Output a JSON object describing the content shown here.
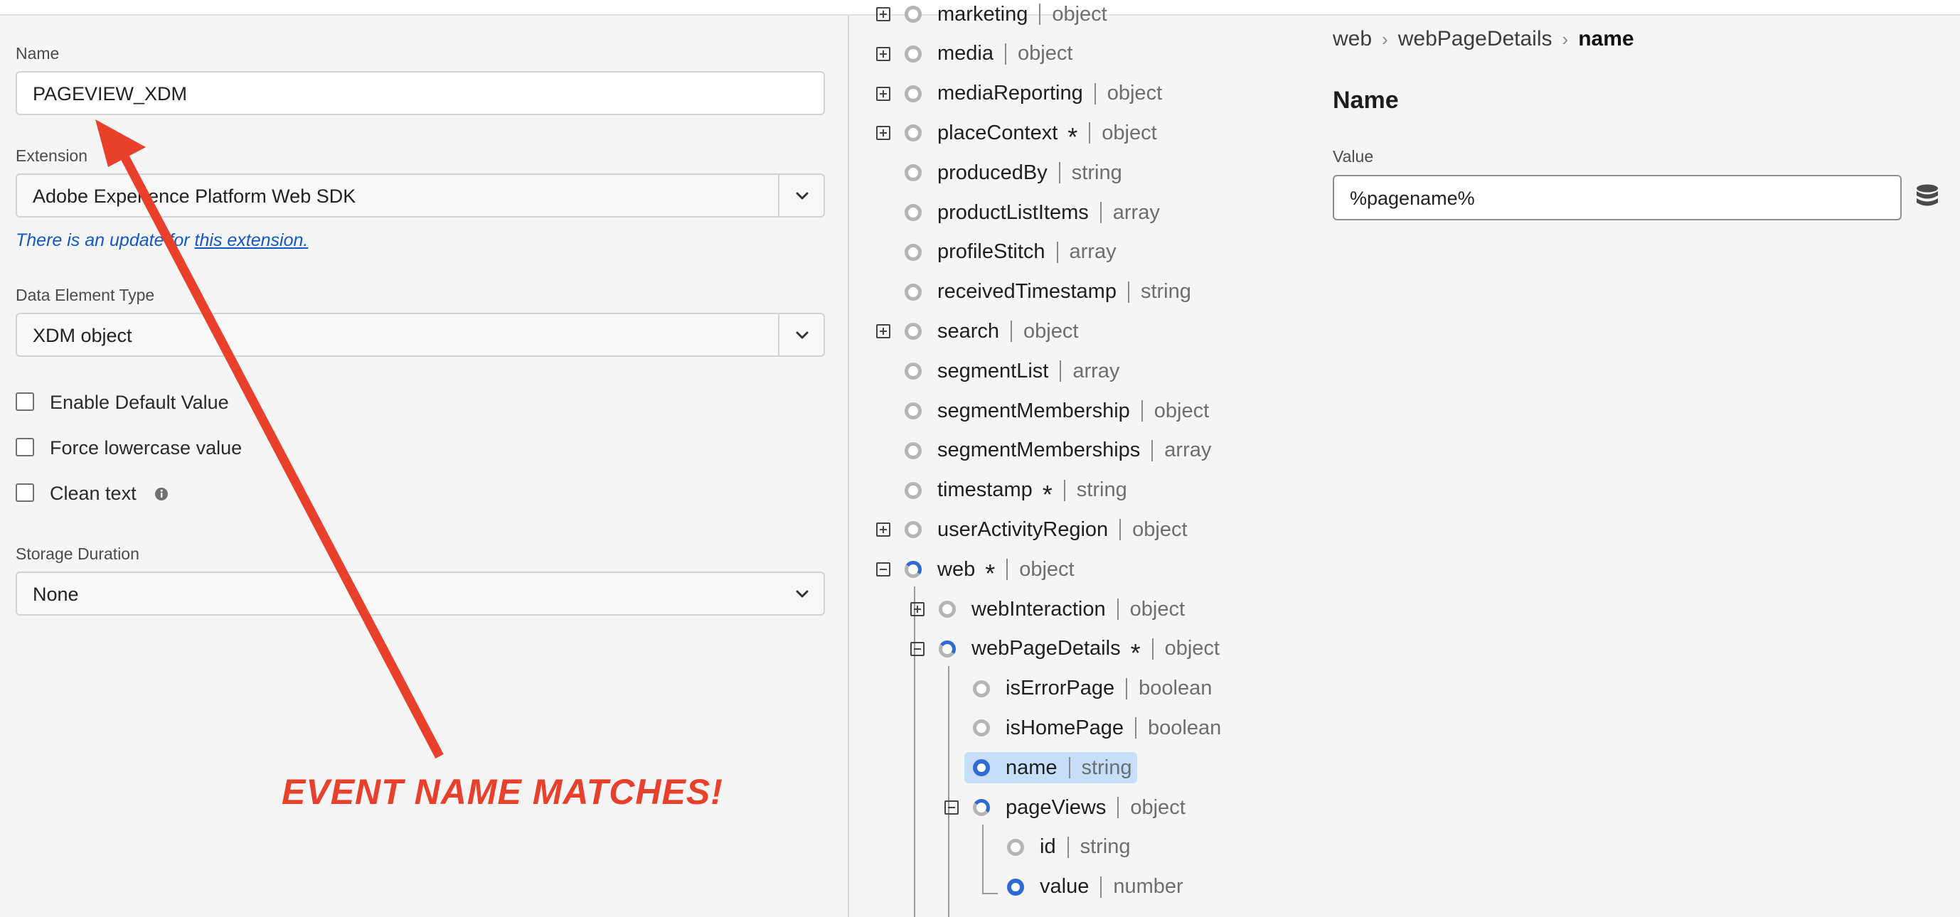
{
  "form": {
    "name_label": "Name",
    "name_value": "PAGEVIEW_XDM",
    "extension_label": "Extension",
    "extension_value": "Adobe Experience Platform Web SDK",
    "update_notice_prefix": "There is an update for ",
    "update_notice_link": "this extension.",
    "type_label": "Data Element Type",
    "type_value": "XDM object",
    "checkboxes": [
      {
        "label": "Enable Default Value",
        "checked": false
      },
      {
        "label": "Force lowercase value",
        "checked": false
      },
      {
        "label": "Clean text",
        "checked": false
      }
    ],
    "storage_label": "Storage Duration",
    "storage_value": "None"
  },
  "annotation": {
    "callout": "EVENT NAME MATCHES!",
    "color": "#e8402b"
  },
  "tree": {
    "rows": [
      {
        "name": "marketing",
        "type": "object",
        "required": false,
        "expander": "plus",
        "dot": "empty"
      },
      {
        "name": "media",
        "type": "object",
        "required": false,
        "expander": "plus",
        "dot": "empty"
      },
      {
        "name": "mediaReporting",
        "type": "object",
        "required": false,
        "expander": "plus",
        "dot": "empty"
      },
      {
        "name": "placeContext",
        "type": "object",
        "required": true,
        "expander": "plus",
        "dot": "empty"
      },
      {
        "name": "producedBy",
        "type": "string",
        "required": false,
        "expander": "none",
        "dot": "empty"
      },
      {
        "name": "productListItems",
        "type": "array",
        "required": false,
        "expander": "none",
        "dot": "empty"
      },
      {
        "name": "profileStitch",
        "type": "array",
        "required": false,
        "expander": "none",
        "dot": "empty"
      },
      {
        "name": "receivedTimestamp",
        "type": "string",
        "required": false,
        "expander": "none",
        "dot": "empty"
      },
      {
        "name": "search",
        "type": "object",
        "required": false,
        "expander": "plus",
        "dot": "empty"
      },
      {
        "name": "segmentList",
        "type": "array",
        "required": false,
        "expander": "none",
        "dot": "empty"
      },
      {
        "name": "segmentMembership",
        "type": "object",
        "required": false,
        "expander": "none",
        "dot": "empty"
      },
      {
        "name": "segmentMemberships",
        "type": "array",
        "required": false,
        "expander": "none",
        "dot": "empty"
      },
      {
        "name": "timestamp",
        "type": "string",
        "required": true,
        "expander": "none",
        "dot": "empty"
      },
      {
        "name": "userActivityRegion",
        "type": "object",
        "required": false,
        "expander": "plus",
        "dot": "empty"
      },
      {
        "name": "web",
        "type": "object",
        "required": true,
        "expander": "minus",
        "dot": "partial"
      },
      {
        "name": "webInteraction",
        "type": "object",
        "required": false,
        "expander": "plus",
        "dot": "empty"
      },
      {
        "name": "webPageDetails",
        "type": "object",
        "required": true,
        "expander": "minus",
        "dot": "partial"
      },
      {
        "name": "isErrorPage",
        "type": "boolean",
        "required": false,
        "expander": "none",
        "dot": "empty"
      },
      {
        "name": "isHomePage",
        "type": "boolean",
        "required": false,
        "expander": "none",
        "dot": "empty"
      },
      {
        "name": "name",
        "type": "string",
        "required": false,
        "expander": "none",
        "dot": "full",
        "selected": true
      },
      {
        "name": "pageViews",
        "type": "object",
        "required": false,
        "expander": "minus",
        "dot": "partial"
      },
      {
        "name": "id",
        "type": "string",
        "required": false,
        "expander": "none",
        "dot": "empty"
      },
      {
        "name": "value",
        "type": "number",
        "required": false,
        "expander": "none",
        "dot": "full"
      }
    ]
  },
  "detail": {
    "breadcrumb": [
      "web",
      "webPageDetails",
      "name"
    ],
    "title": "Name",
    "value_label": "Value",
    "value": "%pagename%"
  }
}
